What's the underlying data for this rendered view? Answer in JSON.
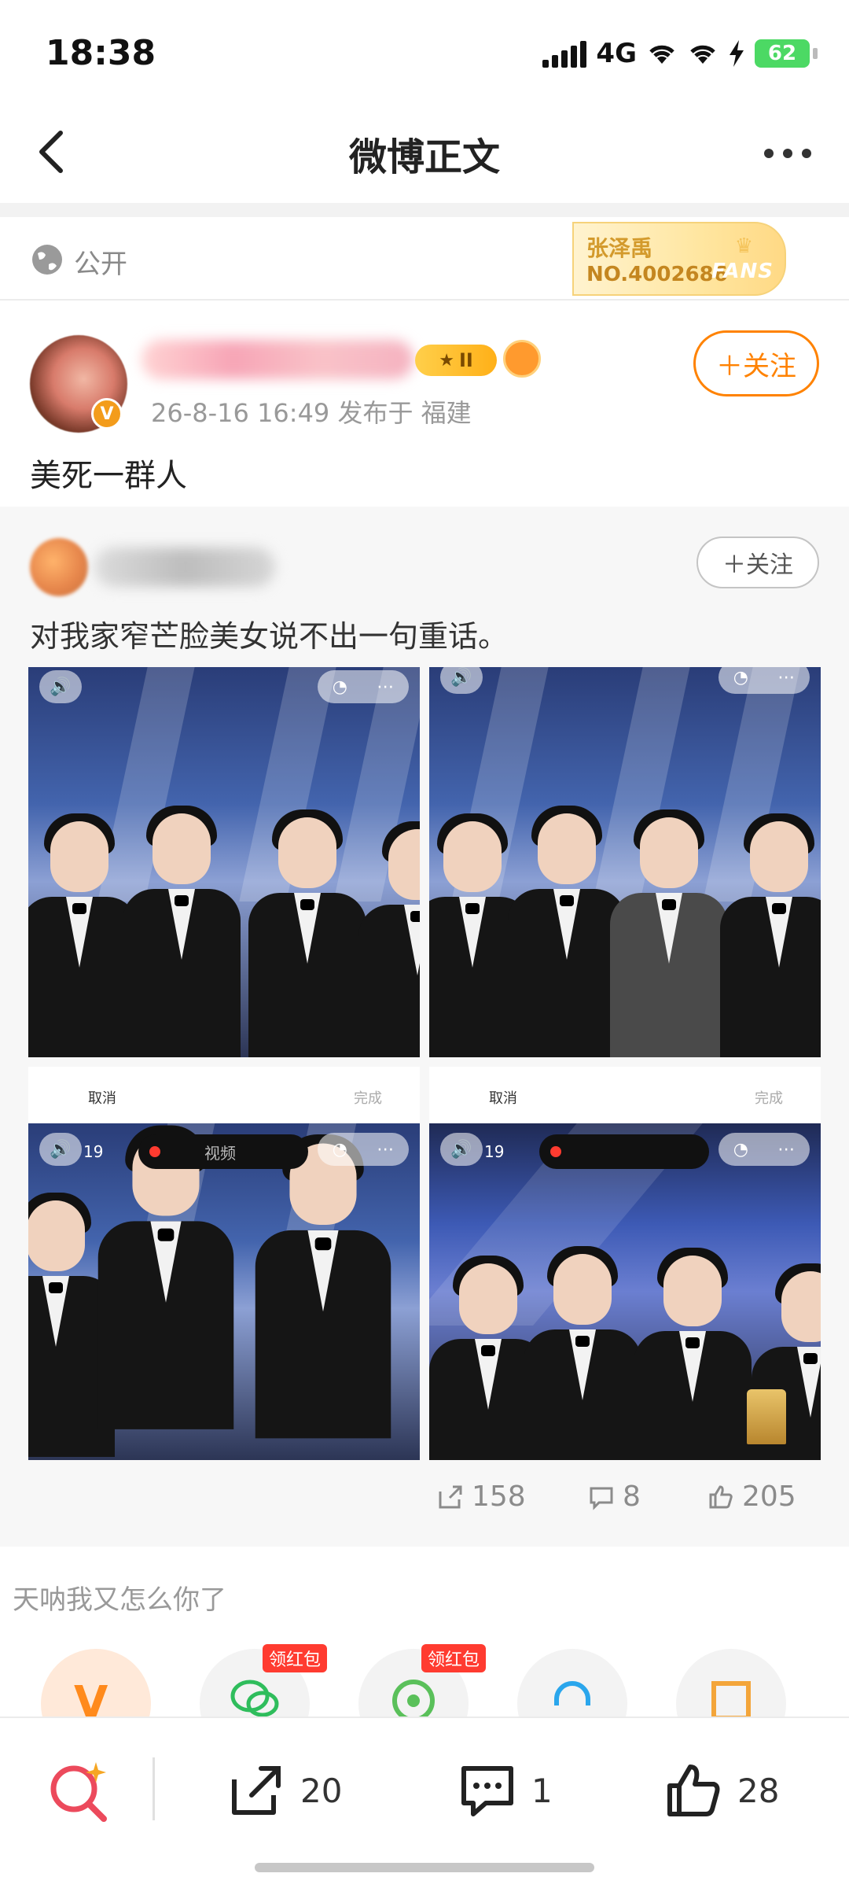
{
  "status_bar": {
    "time": "18:38",
    "network": "4G",
    "battery": "62"
  },
  "header": {
    "title": "微博正文",
    "back_icon": "chevron-left-icon",
    "more_icon": "more-horizontal-icon"
  },
  "visibility": {
    "label": "公开",
    "icon": "globe-icon"
  },
  "fans_badge": {
    "name": "张泽禹",
    "number": "NO.4002686",
    "word": "FANS"
  },
  "post": {
    "level": "II",
    "meta": "26-8-16 16:49  发布于 福建",
    "follow_label": "＋关注",
    "text": "美死一群人",
    "verified_mark": "V"
  },
  "repost": {
    "follow_label": "＋关注",
    "text": "对我家窄芒脸美女说不出一句重话。",
    "photo_overlay": {
      "cancel": "取消",
      "done": "完成",
      "recording_label": "视频",
      "counter": "19"
    },
    "actions": {
      "share": "158",
      "comment": "8",
      "like": "205"
    }
  },
  "emoji_caption": "天呐我又怎么你了",
  "share_targets": {
    "badge_1": "领红包",
    "badge_2": "领红包"
  },
  "bottom_bar": {
    "share_count": "20",
    "comment_count": "1",
    "like_count": "28"
  },
  "colors": {
    "accent_orange": "#ff8200",
    "badge_red": "#ff3b30"
  }
}
